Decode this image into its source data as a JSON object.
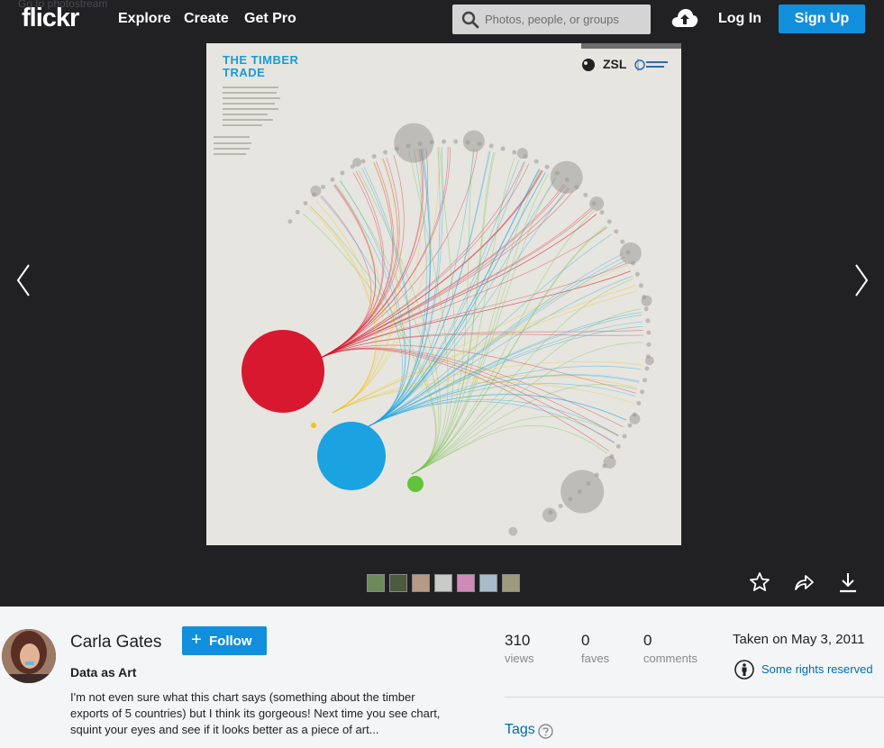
{
  "header": {
    "logo": "flickr",
    "nav": [
      "Explore",
      "Create",
      "Get Pro"
    ],
    "search_placeholder": "Photos, people, or groups",
    "login": "Log In",
    "signup": "Sign Up",
    "back_link": "Go to photostream"
  },
  "photo": {
    "title_line1": "THE TIMBER",
    "title_line2": "TRADE",
    "logo_zsl": "ZSL"
  },
  "owner": {
    "name": "Carla Gates",
    "follow_label": "Follow"
  },
  "details": {
    "title": "Data as Art",
    "description": "I'm not even sure what this chart says (something about the timber exports of 5 countries) but I think its gorgeous! Next time you see chart, squint your eyes and see if it looks better as a piece of art..."
  },
  "stats": {
    "views": "310",
    "views_label": "views",
    "faves": "0",
    "faves_label": "faves",
    "comments": "0",
    "comments_label": "comments"
  },
  "taken": "Taken on May 3, 2011",
  "license": "Some rights reserved",
  "tags_label": "Tags",
  "colors": {
    "brand_blue": "#128fdc",
    "link_blue": "#006dac",
    "viewer_bg": "#212124"
  }
}
